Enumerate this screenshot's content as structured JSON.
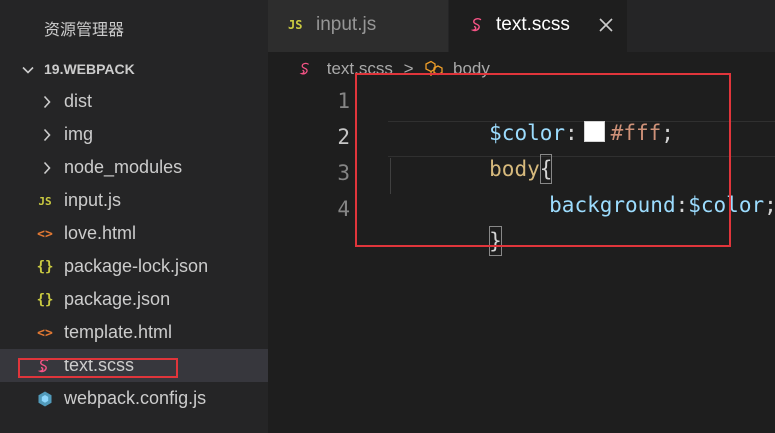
{
  "explorer": {
    "title": "资源管理器",
    "folder": "19.WEBPACK",
    "items": [
      {
        "label": "dist",
        "icon": "chevron-right-icon"
      },
      {
        "label": "img",
        "icon": "chevron-right-icon"
      },
      {
        "label": "node_modules",
        "icon": "chevron-right-icon"
      },
      {
        "label": "input.js",
        "icon": "js-file-icon",
        "glyph": "JS"
      },
      {
        "label": "love.html",
        "icon": "html-file-icon",
        "glyph": "<>"
      },
      {
        "label": "package-lock.json",
        "icon": "json-file-icon",
        "glyph": "{}"
      },
      {
        "label": "package.json",
        "icon": "json-file-icon",
        "glyph": "{}"
      },
      {
        "label": "template.html",
        "icon": "html-file-icon",
        "glyph": "<>"
      },
      {
        "label": "text.scss",
        "icon": "sass-file-icon",
        "selected": true
      },
      {
        "label": "webpack.config.js",
        "icon": "webpack-file-icon"
      }
    ]
  },
  "tabs": [
    {
      "label": "input.js",
      "icon": "js-file-icon",
      "glyph": "JS",
      "active": false
    },
    {
      "label": "text.scss",
      "icon": "sass-file-icon",
      "active": true
    }
  ],
  "breadcrumb": {
    "file": "text.scss",
    "symbol": "body",
    "separator": ">"
  },
  "editor": {
    "line_numbers": [
      "1",
      "2",
      "3",
      "4"
    ],
    "active_line": 2,
    "lines": {
      "l1_var": "$color",
      "l1_colon": ":",
      "l1_value": "#fff",
      "l1_semi": ";",
      "l2_selector": "body",
      "l2_open": "{",
      "l3_prop": "background",
      "l3_colon": ":",
      "l3_value": "$color",
      "l3_semi": ";",
      "l4_close": "}"
    },
    "swatch_color": "#ffffff"
  },
  "colors": {
    "highlight_box": "#e0353b",
    "sass_icon": "#f55385",
    "js_icon": "#cbcb41",
    "html_icon": "#e37933",
    "webpack_icon": "#519aba"
  }
}
